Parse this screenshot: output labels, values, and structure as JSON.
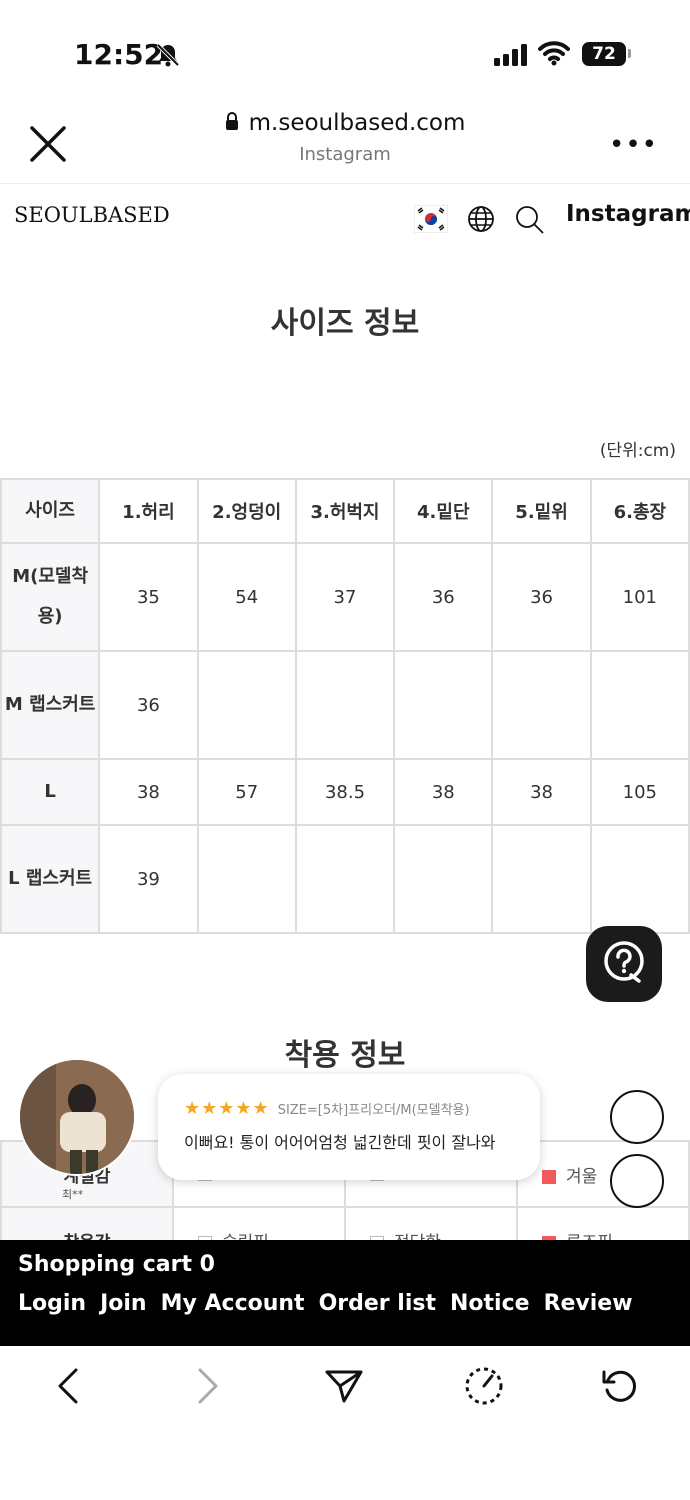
{
  "status_bar": {
    "time": "12:52",
    "battery": "72"
  },
  "browser": {
    "url": "m.seoulbased.com",
    "source": "Instagram",
    "more": "•••"
  },
  "site_header": {
    "logo": "SEOULBASED",
    "instagram_label": "Instagram"
  },
  "size_section": {
    "title": "사이즈 정보",
    "unit": "(단위:cm)",
    "headers": [
      "사이즈",
      "1.허리",
      "2.엉덩이",
      "3.허벅지",
      "4.밑단",
      "5.밑위",
      "6.총장"
    ],
    "rows": [
      [
        "M(모델착용)",
        "35",
        "54",
        "37",
        "36",
        "36",
        "101"
      ],
      [
        "M 랩스커트",
        "36",
        "",
        "",
        "",
        "",
        ""
      ],
      [
        "L",
        "38",
        "57",
        "38.5",
        "38",
        "38",
        "105"
      ],
      [
        "L 랩스커트",
        "39",
        "",
        "",
        "",
        "",
        ""
      ]
    ]
  },
  "fit_section": {
    "title": "착용 정보",
    "rows": [
      [
        "계절감",
        "",
        "",
        "겨울"
      ],
      [
        "착용감",
        "슬림핏",
        "적당한",
        "루즈핏"
      ]
    ]
  },
  "review_popup": {
    "stars": "★★★★★",
    "option": "SIZE=[5차]프리오더/M(모델착용)",
    "text": "이뻐요! 통이 어어어엄청 넓긴한데 핏이 잘나와",
    "reviewer": "최**"
  },
  "footer": {
    "cart": "Shopping cart 0",
    "links": [
      "Login",
      "Join",
      "My Account",
      "Order list",
      "Notice",
      "Review"
    ]
  },
  "colors": {
    "accent": "#f05a5a",
    "star": "#f5a623"
  }
}
